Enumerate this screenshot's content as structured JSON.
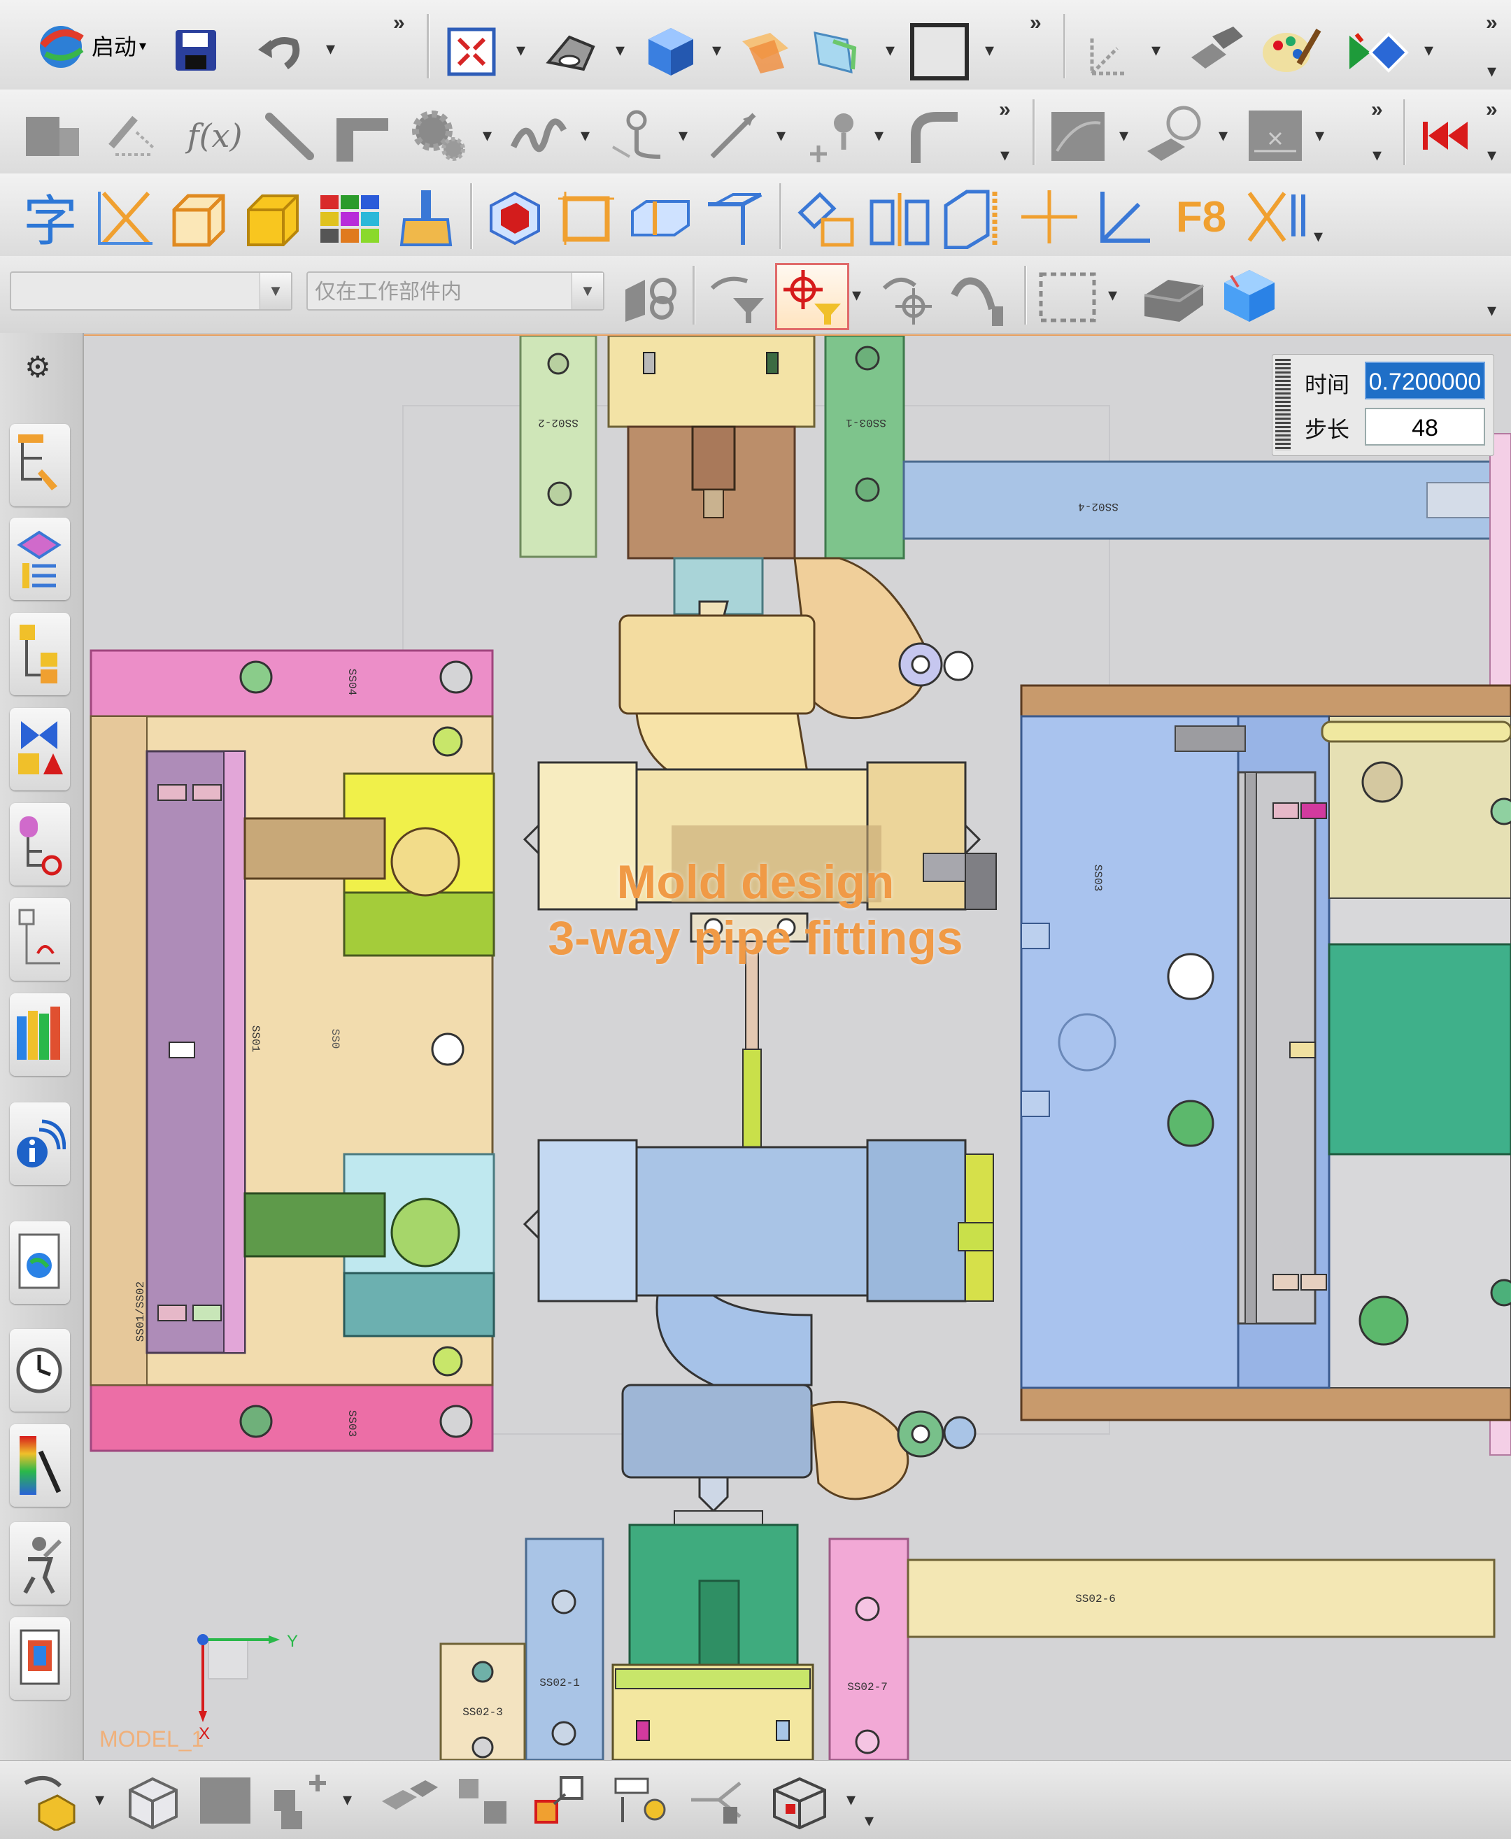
{
  "toolbar1": {
    "start_label": "启动",
    "overflow": "»"
  },
  "toolbar2": {
    "fx_label": "f(x)",
    "overflow": "»"
  },
  "toolbar3": {
    "char_label": "字",
    "f8_label": "F8"
  },
  "selection_bar": {
    "type_filter_value": "",
    "scope_filter_value": "仅在工作部件内"
  },
  "time_panel": {
    "time_label": "时间",
    "time_value": "0.7200000",
    "step_label": "步长",
    "step_value": "48"
  },
  "overlay": {
    "line1": "Mold design",
    "line2": "3-way pipe fittings"
  },
  "viewport": {
    "model_label": "MODEL_1",
    "triad_y": "Y",
    "triad_x": "X",
    "part_labels": {
      "top_left_plate": "SS02-2",
      "top_right_plate": "SS03-1",
      "top_rail": "SS02-4",
      "pink_top": "SS04",
      "pink_bottom": "SS03",
      "left_slider": "SS01",
      "left_slider_text2": "SS0",
      "left_side_text": "SS01/SS02",
      "right_block": "SS03",
      "bottom_rail": "SS02-6",
      "bottom_left_plate": "SS02-1",
      "bottom_right_plate": "SS02-7",
      "bottom_small": "SS02-3"
    }
  },
  "colors": {
    "accent_orange": "#f09a46",
    "viewport_bg": "#d4d4d6",
    "time_field_bg": "#1f6fc7"
  }
}
